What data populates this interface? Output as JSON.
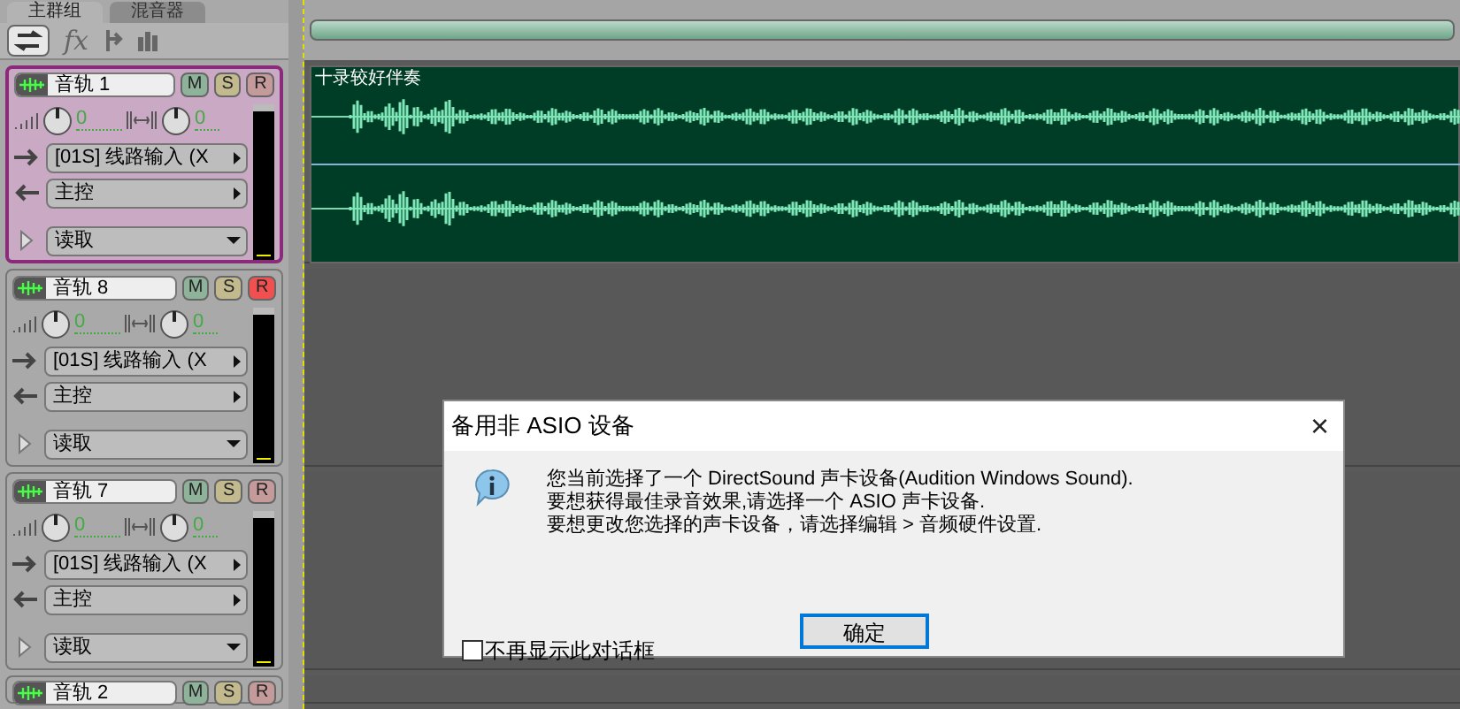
{
  "tabs": [
    {
      "label": "主群组",
      "selected": true
    },
    {
      "label": "混音器",
      "selected": false
    }
  ],
  "toolbar": [
    {
      "kind": "io"
    },
    {
      "kind": "fx",
      "label": "fx"
    },
    {
      "kind": "send"
    },
    {
      "kind": "eq"
    }
  ],
  "tracks": [
    {
      "kind": "full",
      "name": "音轨 1",
      "selected": true,
      "mute": "M",
      "solo": "S",
      "rec": "R",
      "armed": false,
      "volume": "0",
      "pan": "0",
      "input": "[01S] 线路输入 (X",
      "output": "主控",
      "automation": "读取",
      "clip": "十录较好伴奏"
    },
    {
      "kind": "full",
      "name": "音轨 8",
      "selected": false,
      "mute": "M",
      "solo": "S",
      "rec": "R",
      "armed": true,
      "volume": "0",
      "pan": "0",
      "input": "[01S] 线路输入 (X",
      "output": "主控",
      "automation": "读取"
    },
    {
      "kind": "full",
      "name": "音轨 7",
      "selected": false,
      "mute": "M",
      "solo": "S",
      "rec": "R",
      "armed": false,
      "volume": "0",
      "pan": "0",
      "input": "[01S] 线路输入 (X",
      "output": "主控",
      "automation": "读取"
    },
    {
      "kind": "header",
      "name": "音轨 2",
      "selected": false,
      "mute": "M",
      "solo": "S",
      "rec": "R",
      "armed": false
    }
  ],
  "dialog": {
    "title": "备用非 ASIO 设备",
    "close": "×",
    "lines": [
      "您当前选择了一个 DirectSound 声卡设备(Audition Windows Sound).",
      "要想获得最佳录音效果,请选择一个 ASIO 声卡设备.",
      "要想更改您选择的声卡设备，请选择编辑 > 音频硬件设置."
    ],
    "ok": "确定",
    "checkbox": {
      "label": "不再显示此对话框",
      "checked": false
    }
  }
}
